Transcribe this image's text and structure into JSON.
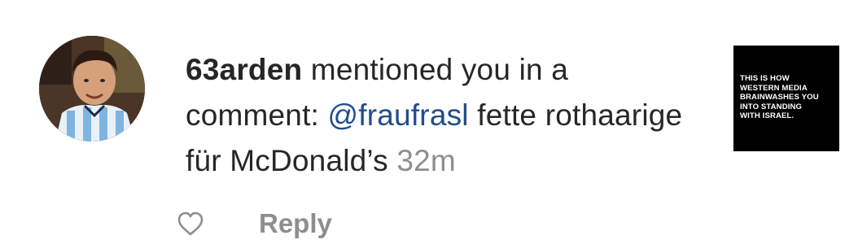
{
  "notification": {
    "username": "63arden",
    "action_text": " mentioned you in a comment: ",
    "mention": "@fraufrasl",
    "comment_text": " fette rothaarige für McDonald’s ",
    "timestamp": "32m",
    "post_thumbnail": {
      "text": "THIS IS HOW\nWESTERN MEDIA\nBRAINWASHES YOU\nINTO STANDING\nWITH ISRAEL.",
      "background": "#000000"
    },
    "actions": {
      "like_icon": "heart-outline-icon",
      "reply_label": "Reply"
    }
  },
  "colors": {
    "text": "#262626",
    "mention": "#1f4d8c",
    "muted": "#8e8e8e"
  }
}
